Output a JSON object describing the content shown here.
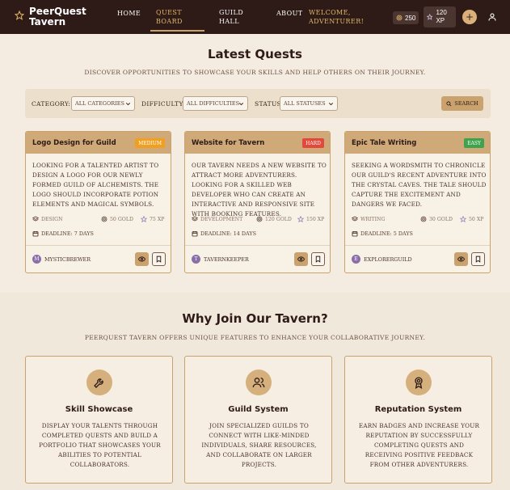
{
  "nav": {
    "brand": "PeerQuest Tavern",
    "links": [
      "Home",
      "Quest Board",
      "Guild Hall",
      "About"
    ],
    "active": "Quest Board",
    "welcome": "Welcome, Adventurer!",
    "gold": "250",
    "xp": "120 XP",
    "add_label": "+"
  },
  "quests": {
    "title": "Latest Quests",
    "subtitle": "Discover opportunities to showcase your skills and help others on their journey.",
    "filters": {
      "category_label": "Category:",
      "category_value": "All Categories",
      "difficulty_label": "Difficulty:",
      "difficulty_value": "All Difficulties",
      "status_label": "Status:",
      "status_value": "All Statuses",
      "search_label": "Search"
    },
    "cards": [
      {
        "title": "Logo Design for Guild",
        "difficulty": "Medium",
        "difficulty_color": "#f0a020",
        "description": "Looking for a talented artist to design a logo for our newly formed guild of alchemists. The logo should incorporate potion elements and magical symbols.",
        "category": "Design",
        "gold": "50 Gold",
        "xp": "75 XP",
        "deadline": "Deadline: 7 days",
        "author": "MysticBrewer",
        "initial": "M"
      },
      {
        "title": "Website for Tavern",
        "difficulty": "Hard",
        "difficulty_color": "#e2493a",
        "description": "Our tavern needs a new website to attract more adventurers. Looking for a skilled web developer who can create an interactive and responsive site with booking features.",
        "category": "Development",
        "gold": "120 Gold",
        "xp": "150 XP",
        "deadline": "Deadline: 14 days",
        "author": "TavernKeeper",
        "initial": "T"
      },
      {
        "title": "Epic Tale Writing",
        "difficulty": "Easy",
        "difficulty_color": "#3fa34d",
        "description": "Seeking a wordsmith to chronicle our guild's recent adventure into the Crystal Caves. The tale should capture the excitement and dangers we faced.",
        "category": "Writing",
        "gold": "30 Gold",
        "xp": "50 XP",
        "deadline": "Deadline: 5 days",
        "author": "ExplorerGuild",
        "initial": "E"
      }
    ]
  },
  "why": {
    "title": "Why Join Our Tavern?",
    "subtitle": "PeerQuest Tavern offers unique features to enhance your collaborative journey.",
    "features": [
      {
        "icon": "wrench-icon",
        "title": "Skill Showcase",
        "description": "Display your talents through completed quests and build a portfolio that showcases your abilities to potential collaborators."
      },
      {
        "icon": "users-icon",
        "title": "Guild System",
        "description": "Join specialized guilds to connect with like-minded individuals, share resources, and collaborate on larger projects."
      },
      {
        "icon": "award-icon",
        "title": "Reputation System",
        "description": "Earn badges and increase your reputation by successfully completing quests and receiving positive feedback from other adventurers."
      }
    ]
  }
}
